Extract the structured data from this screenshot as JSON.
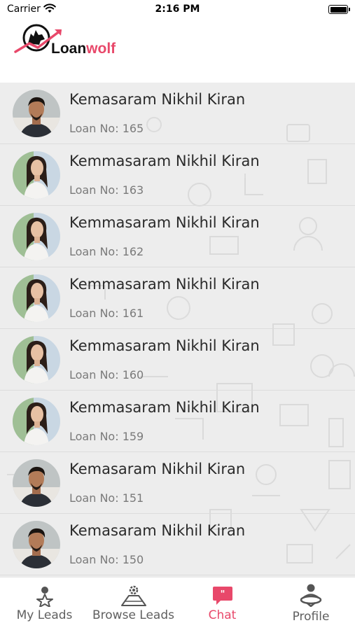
{
  "status_bar": {
    "carrier": "Carrier",
    "time": "2:16 PM"
  },
  "header": {
    "logo_text_main": "Loan",
    "logo_text_accent": "wolf",
    "brand_color": "#e8486a"
  },
  "leads": [
    {
      "name": "Kemasaram Nikhil Kiran",
      "loan": "Loan No: 165",
      "avatar": "male"
    },
    {
      "name": "Kemmasaram Nikhil Kiran",
      "loan": "Loan No: 163",
      "avatar": "female"
    },
    {
      "name": "Kemmasaram Nikhil Kiran",
      "loan": "Loan No: 162",
      "avatar": "female"
    },
    {
      "name": "Kemmasaram Nikhil Kiran",
      "loan": "Loan No: 161",
      "avatar": "female"
    },
    {
      "name": "Kemmasaram Nikhil Kiran",
      "loan": "Loan No: 160",
      "avatar": "female"
    },
    {
      "name": "Kemmasaram Nikhil Kiran",
      "loan": "Loan No: 159",
      "avatar": "female"
    },
    {
      "name": "Kemasaram Nikhil Kiran",
      "loan": "Loan No: 151",
      "avatar": "male"
    },
    {
      "name": "Kemasaram Nikhil Kiran",
      "loan": "Loan No: 150",
      "avatar": "male"
    }
  ],
  "tabs": [
    {
      "label": "My Leads",
      "icon": "person-star-icon",
      "active": false
    },
    {
      "label": "Browse Leads",
      "icon": "browse-leads-icon",
      "active": false
    },
    {
      "label": "Chat",
      "icon": "chat-icon",
      "active": true
    },
    {
      "label": "Profile",
      "icon": "profile-icon",
      "active": false
    }
  ]
}
